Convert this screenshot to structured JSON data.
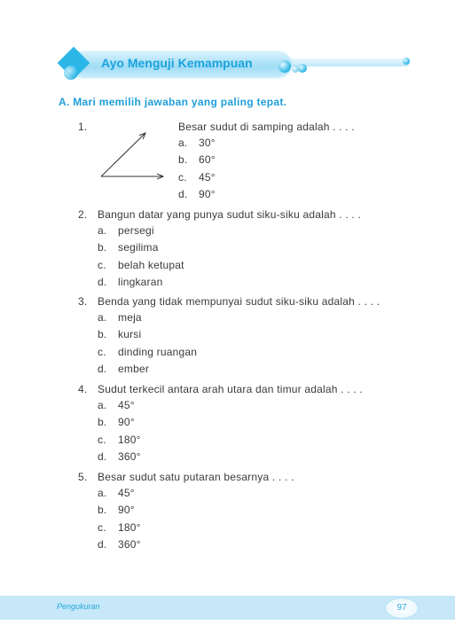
{
  "banner": {
    "title": "Ayo Menguji Kemampuan"
  },
  "section": {
    "label": "A.  Mari memilih jawaban yang paling tepat."
  },
  "questions": [
    {
      "number": "1.",
      "text": "Besar sudut di samping adalah . . . .",
      "options": [
        {
          "letter": "a.",
          "text": "30°"
        },
        {
          "letter": "b.",
          "text": "60°"
        },
        {
          "letter": "c.",
          "text": "45°"
        },
        {
          "letter": "d.",
          "text": "90°"
        }
      ]
    },
    {
      "number": "2.",
      "text": "Bangun datar yang punya sudut siku-siku adalah . . . .",
      "options": [
        {
          "letter": "a.",
          "text": "persegi"
        },
        {
          "letter": "b.",
          "text": "segilima"
        },
        {
          "letter": "c.",
          "text": "belah ketupat"
        },
        {
          "letter": "d.",
          "text": "lingkaran"
        }
      ]
    },
    {
      "number": "3.",
      "text": "Benda yang tidak mempunyai sudut siku-siku adalah . . . .",
      "options": [
        {
          "letter": "a.",
          "text": "meja"
        },
        {
          "letter": "b.",
          "text": "kursi"
        },
        {
          "letter": "c.",
          "text": "dinding ruangan"
        },
        {
          "letter": "d.",
          "text": "ember"
        }
      ]
    },
    {
      "number": "4.",
      "text": "Sudut terkecil antara arah utara dan timur adalah . . . .",
      "options": [
        {
          "letter": "a.",
          "text": "45°"
        },
        {
          "letter": "b.",
          "text": "90°"
        },
        {
          "letter": "c.",
          "text": "180°"
        },
        {
          "letter": "d.",
          "text": "360°"
        }
      ]
    },
    {
      "number": "5.",
      "text": "Besar sudut satu putaran besarnya . . . .",
      "options": [
        {
          "letter": "a.",
          "text": "45°"
        },
        {
          "letter": "b.",
          "text": "90°"
        },
        {
          "letter": "c.",
          "text": "180°"
        },
        {
          "letter": "d.",
          "text": "360°"
        }
      ]
    }
  ],
  "footer": {
    "chapter": "Pengukuran",
    "page": "97"
  }
}
